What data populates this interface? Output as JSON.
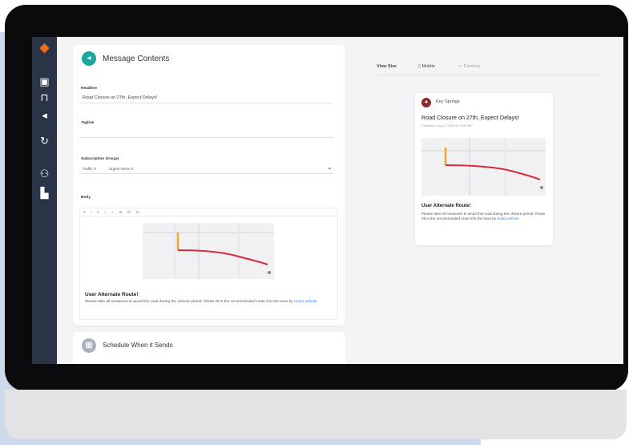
{
  "editor": {
    "section_title": "Message Contents",
    "headline_label": "Headline",
    "headline_value": "Road Closure on 27th, Expect Delays!",
    "tagline_label": "Tagline",
    "groups_label": "Subscription Groups",
    "groups": [
      "Traffic",
      "Urgent Alerts"
    ],
    "body_label": "Body",
    "toolbar_glyphs": "B I S ≡ ∞ ⊞ ⌧ ⊟",
    "body_heading": "User Alternate Route!",
    "body_text": "Please take all measures to avoid this road during the closure period. Route 28 is the recommended route into the town by",
    "body_link": "motor vehicle"
  },
  "schedule": {
    "title": "Schedule When it Sends"
  },
  "preview": {
    "view_size_label": "View Size",
    "mobile_label": "Mobile",
    "desktop_label": "Desktop",
    "sender": "Key Springs",
    "headline": "Road Closure on 27th, Expect Delays!",
    "published": "Published: Aug 3, 2023 @ 3:08 PM",
    "body_heading": "User Alternate Route!",
    "body_text": "Please take all measures to avoid this road during the closure period. Route 28 is the recommended route into the town by",
    "body_link": "motor vehicle"
  },
  "colors": {
    "brand_orange": "#f36b22",
    "teal": "#1aa89c",
    "sidebar": "#2a3447",
    "route_red": "#d62b3a"
  },
  "icons": [
    "logo-pin-icon",
    "id-card-icon",
    "lock-icon",
    "megaphone-icon",
    "refresh-icon",
    "people-icon",
    "chart-icon"
  ]
}
